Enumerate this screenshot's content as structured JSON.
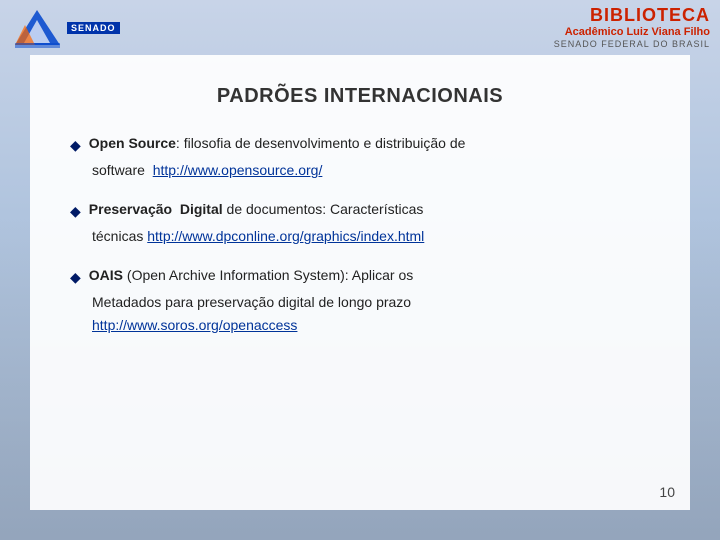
{
  "header": {
    "biblioteca_label": "BIBLIOTECA",
    "academico_label": "Acadêmico Luiz Viana Filho",
    "senado_federal_label": "SENADO FEDERAL DO BRASIL",
    "senado_badge": "SENADO",
    "logo_alt": "Senado Logo"
  },
  "page": {
    "title": "PADRÕES INTERNACIONAIS",
    "page_number": "10"
  },
  "bullets": [
    {
      "id": "open-source",
      "strong_label": "Open Source",
      "text_before": ": filosofia de desenvolvimento e distribuição de",
      "indent_text": "software  ",
      "link_text": "http://www.opensource.org/",
      "link_href": "http://www.opensource.org/"
    },
    {
      "id": "preservacao",
      "strong_label": "Preservação",
      "extra_strong": "Digital",
      "text_before": " de documentos: Características",
      "indent_text": "técnicas ",
      "link_text": "http://www.dpconline.org/graphics/index.html",
      "link_href": "http://www.dpconline.org/graphics/index.html"
    },
    {
      "id": "oais",
      "strong_label": "OAIS",
      "text_before": " (Open Archive Information System): Aplicar os",
      "indent_text": "Metadados para preservação digital de longo prazo",
      "link_text": "http://www.soros.org/openaccess",
      "link_href": "http://www.soros.org/openaccess"
    }
  ]
}
